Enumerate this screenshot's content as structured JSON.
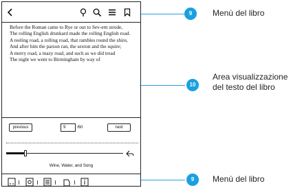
{
  "reader": {
    "toolbar_icons": [
      "back-icon",
      "lightbulb-icon",
      "search-icon",
      "menu-icon",
      "bookmark-icon"
    ],
    "paragraphs": [
      "Before the Roman came to Rye or out to Sev-ern strode,",
      "The rolling English drunkard made the rolling English road.",
      "A reeling road, a rolling road, that rambles round the shire,",
      "And after him the parson ran, the sexton and the squire;",
      "A merry road, a mazy road, and such as we did tread",
      "The night we went to Birmingham by way of"
    ],
    "nav": {
      "previous_label": "previous",
      "page_value": "9",
      "total_pages": "/60",
      "next_label": "next"
    },
    "progress_fraction": 0.15,
    "book_title": "Wine, Water, and Song",
    "bottom_icons": [
      "toc-icon",
      "settings-icon",
      "notes-icon",
      "orientation-icon",
      "info-icon"
    ]
  },
  "callouts": {
    "top": {
      "number": "9",
      "label": "Menù del libro"
    },
    "middle": {
      "number": "10",
      "label_line1": "Area visualizzazione",
      "label_line2": "del testo del libro"
    },
    "bottom": {
      "number": "9",
      "label": "Menù del libro"
    }
  },
  "colors": {
    "accent": "#1aa0e0"
  }
}
